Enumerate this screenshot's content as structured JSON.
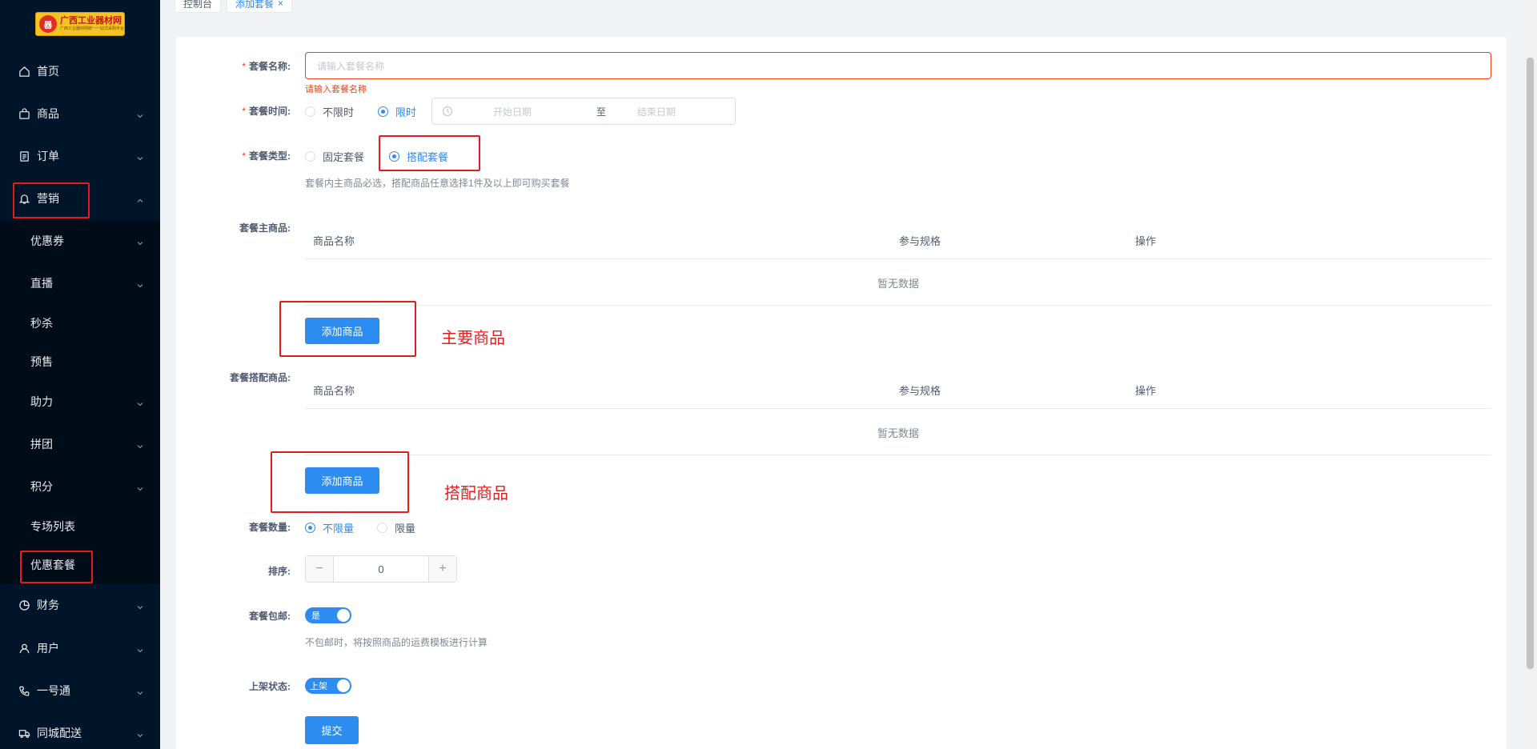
{
  "logo": {
    "title": "广西工业器材网",
    "subtitle": "广西工业器材网统一一站式采购平台",
    "mark": "器"
  },
  "sidebar": {
    "items": [
      {
        "label": "首页",
        "icon": "home-icon"
      },
      {
        "label": "商品",
        "icon": "bag-icon"
      },
      {
        "label": "订单",
        "icon": "document-icon"
      },
      {
        "label": "营销",
        "icon": "bell-icon"
      },
      {
        "label": "财务",
        "icon": "pie-chart-icon"
      },
      {
        "label": "用户",
        "icon": "user-icon"
      },
      {
        "label": "一号通",
        "icon": "phone-icon"
      },
      {
        "label": "同城配送",
        "icon": "truck-icon"
      }
    ],
    "submenu": [
      {
        "label": "优惠券"
      },
      {
        "label": "直播"
      },
      {
        "label": "秒杀"
      },
      {
        "label": "预售"
      },
      {
        "label": "助力"
      },
      {
        "label": "拼团"
      },
      {
        "label": "积分"
      },
      {
        "label": "专场列表"
      },
      {
        "label": "优惠套餐"
      }
    ]
  },
  "tabs": [
    {
      "label": "控制台"
    },
    {
      "label": "添加套餐",
      "close": "×"
    }
  ],
  "form": {
    "name_label": "套餐名称:",
    "name_placeholder": "请输入套餐名称",
    "name_error": "请输入套餐名称",
    "time_label": "套餐时间:",
    "time_options": [
      "不限时",
      "限时"
    ],
    "time_selected": "限时",
    "date_start_placeholder": "开始日期",
    "date_separator": "至",
    "date_end_placeholder": "结束日期",
    "type_label": "套餐类型:",
    "type_options": [
      "固定套餐",
      "搭配套餐"
    ],
    "type_selected": "搭配套餐",
    "type_hint": "套餐内主商品必选，搭配商品任意选择1件及以上即可购买套餐",
    "main_goods_label": "套餐主商品:",
    "match_goods_label": "套餐搭配商品:",
    "table_columns": [
      "商品名称",
      "参与规格",
      "操作"
    ],
    "empty_text": "暂无数据",
    "add_goods_button": "添加商品",
    "quantity_label": "套餐数量:",
    "quantity_options": [
      "不限量",
      "限量"
    ],
    "quantity_selected": "不限量",
    "sort_label": "排序:",
    "sort_value": "0",
    "shipping_label": "套餐包邮:",
    "shipping_switch": "是",
    "shipping_hint": "不包邮时，将按照商品的运费模板进行计算",
    "status_label": "上架状态:",
    "status_switch": "上架",
    "submit_button": "提交"
  },
  "annotations": {
    "main_goods": "主要商品",
    "match_goods": "搭配商品",
    "color": "#e61c1c"
  },
  "colors": {
    "primary": "#2d8cf0",
    "sidebar": "#001529",
    "error": "#ed4014"
  }
}
